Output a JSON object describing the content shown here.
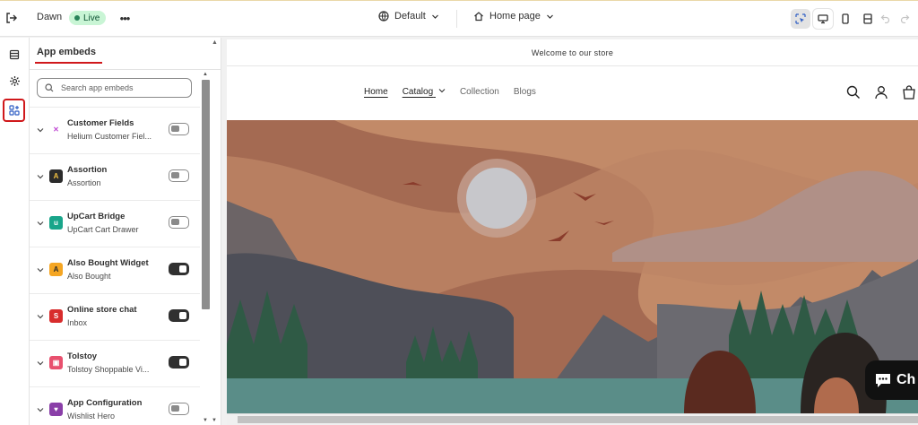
{
  "topbar": {
    "theme_name": "Dawn",
    "status_badge": "Live",
    "more_label": "•••",
    "template_label": "Default",
    "page_label": "Home page"
  },
  "rail": {
    "items": [
      {
        "icon": "sections-icon"
      },
      {
        "icon": "settings-icon"
      },
      {
        "icon": "app-embeds-icon",
        "selected": true
      }
    ]
  },
  "panel": {
    "title": "App embeds",
    "search_placeholder": "Search app embeds",
    "embeds": [
      {
        "name": "Customer Fields",
        "subtitle": "Helium Customer Fiel...",
        "enabled": false,
        "icon_color": "#ffffff",
        "icon_glyph": "✕",
        "icon_fg": "#c04bd4"
      },
      {
        "name": "Assortion",
        "subtitle": "Assortion",
        "enabled": false,
        "icon_color": "#2b2b2b",
        "icon_glyph": "A",
        "icon_fg": "#f0c040"
      },
      {
        "name": "UpCart Bridge",
        "subtitle": "UpCart Cart Drawer",
        "enabled": false,
        "icon_color": "#19a58a",
        "icon_glyph": "u",
        "icon_fg": "#ffffff"
      },
      {
        "name": "Also Bought Widget",
        "subtitle": "Also Bought",
        "enabled": true,
        "icon_color": "#f5a623",
        "icon_glyph": "A",
        "icon_fg": "#2b2b2b"
      },
      {
        "name": "Online store chat",
        "subtitle": "Inbox",
        "enabled": true,
        "icon_color": "#d82c2c",
        "icon_glyph": "S",
        "icon_fg": "#ffffff"
      },
      {
        "name": "Tolstoy",
        "subtitle": "Tolstoy Shoppable Vi...",
        "enabled": true,
        "icon_color": "#e8506e",
        "icon_glyph": "▣",
        "icon_fg": "#ffffff"
      },
      {
        "name": "App Configuration",
        "subtitle": "Wishlist Hero",
        "enabled": false,
        "icon_color": "#8a3fa8",
        "icon_glyph": "♥",
        "icon_fg": "#ffffff"
      }
    ]
  },
  "preview": {
    "announcement": "Welcome to our store",
    "nav": [
      {
        "label": "Home",
        "active": true
      },
      {
        "label": "Catalog",
        "dropdown": true
      },
      {
        "label": "Collection"
      },
      {
        "label": "Blogs"
      }
    ],
    "chat_label": "Ch"
  },
  "colors": {
    "accent_red": "#d0181b",
    "live_badge_bg": "#c9f5d5",
    "toggle_on": "#303030"
  }
}
